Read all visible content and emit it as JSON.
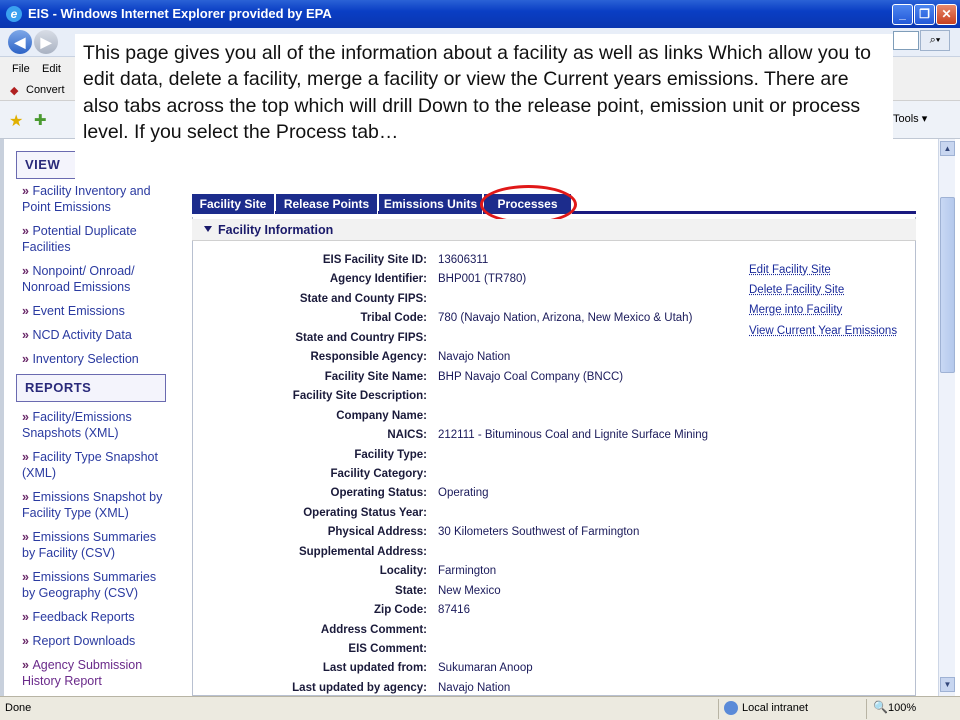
{
  "window": {
    "title": "EIS - Windows Internet Explorer provided by EPA",
    "minimize": "_",
    "restore": "❐",
    "close": "✕"
  },
  "browser": {
    "menu": [
      "File",
      "Edit"
    ],
    "convert_label": "Convert",
    "tools_label": "Tools"
  },
  "callout": {
    "text": "This page gives you all of the information about a facility as well as links Which allow you to edit data, delete a facility, merge a facility or view the Current years emissions.  There are also tabs across the top which will drill Down to the release point, emission unit or process level.  If you select the Process tab…"
  },
  "sidebar": {
    "view_header": "VIEW",
    "view_items": [
      "Facility Inventory and Point Emissions",
      "Potential Duplicate Facilities",
      "Nonpoint/ Onroad/ Nonroad Emissions",
      "Event Emissions",
      "NCD Activity Data",
      "Inventory Selection"
    ],
    "reports_header": "REPORTS",
    "report_items": [
      "Facility/Emissions Snapshots (XML)",
      "Facility Type Snapshot (XML)",
      "Emissions Snapshot by Facility Type (XML)",
      "Emissions Summaries by Facility (CSV)",
      "Emissions Summaries by Geography (CSV)",
      "Feedback Reports",
      "Report Downloads",
      "Agency Submission History Report"
    ]
  },
  "tabs": [
    "Facility Site",
    "Release Points",
    "Emissions Units",
    "Processes"
  ],
  "section_title": "Facility Information",
  "fields": [
    {
      "label": "EIS Facility Site ID:",
      "value": "13606311"
    },
    {
      "label": "Agency Identifier:",
      "value": "BHP001 (TR780)"
    },
    {
      "label": "State and County FIPS:",
      "value": ""
    },
    {
      "label": "Tribal Code:",
      "value": "780 (Navajo Nation, Arizona, New Mexico & Utah)"
    },
    {
      "label": "State and Country FIPS:",
      "value": ""
    },
    {
      "label": "Responsible Agency:",
      "value": "Navajo Nation"
    },
    {
      "label": "Facility Site Name:",
      "value": "BHP Navajo Coal Company (BNCC)"
    },
    {
      "label": "Facility Site Description:",
      "value": ""
    },
    {
      "label": "Company Name:",
      "value": ""
    },
    {
      "label": "NAICS:",
      "value": "212111 - Bituminous Coal and Lignite Surface Mining"
    },
    {
      "label": "Facility Type:",
      "value": ""
    },
    {
      "label": "Facility Category:",
      "value": ""
    },
    {
      "label": "Operating Status:",
      "value": "Operating"
    },
    {
      "label": "Operating Status Year:",
      "value": ""
    },
    {
      "label": "Physical Address:",
      "value": "30 Kilometers Southwest of Farmington"
    },
    {
      "label": "Supplemental Address:",
      "value": ""
    },
    {
      "label": "Locality:",
      "value": "Farmington"
    },
    {
      "label": "State:",
      "value": "New Mexico"
    },
    {
      "label": "Zip Code:",
      "value": "87416"
    },
    {
      "label": "Address Comment:",
      "value": ""
    },
    {
      "label": "EIS Comment:",
      "value": ""
    },
    {
      "label": "Last updated from:",
      "value": "Sukumaran Anoop"
    },
    {
      "label": "Last updated by agency:",
      "value": "Navajo Nation"
    }
  ],
  "actions": [
    "Edit Facility Site",
    "Delete Facility Site",
    "Merge into Facility",
    "View Current Year Emissions"
  ],
  "status": {
    "left": "Done",
    "zone": "Local intranet",
    "zoom": "100%"
  }
}
